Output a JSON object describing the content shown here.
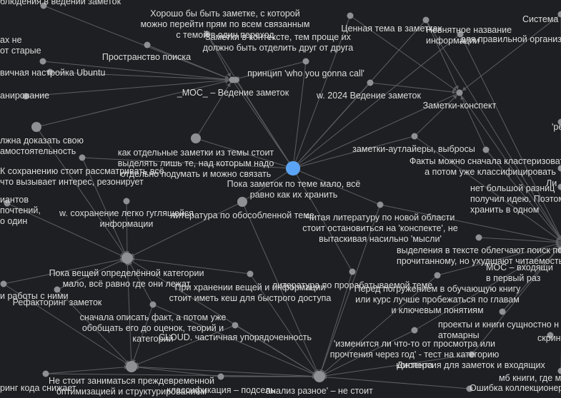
{
  "background_color": "#1e1f22",
  "edge_color": "#5d5f63",
  "node_color": "#8f9094",
  "active_node_color": "#5ba4f5",
  "label_color": "#dcdcdc",
  "nodes": [
    {
      "id": "center",
      "label": "Пока заметок по теме мало, всё\nравно как их хранить",
      "active": true
    },
    {
      "id": "n1",
      "label": "Хорошо бы быть заметке, с которой\nможно перейти прям по всем связанным\nс темой в один переход"
    },
    {
      "id": "n2",
      "label": "Заметки в контексте, тем проще их\nдолжно быть отделить друг от друга"
    },
    {
      "id": "n3",
      "label": "Ценная тема в заметках"
    },
    {
      "id": "n4",
      "label": "Пространство поиска"
    },
    {
      "id": "n5",
      "label": "принцип 'who you gonna call'"
    },
    {
      "id": "n6",
      "label": "_МОС_ – Ведение заметок"
    },
    {
      "id": "n7",
      "label": "w. 2024 Ведение заметок"
    },
    {
      "id": "n8",
      "label": "Заметки-конспект"
    },
    {
      "id": "n9",
      "label": "заметки-аутлайеры, выбросы"
    },
    {
      "id": "n10",
      "label": "Факты можно сначала кластеризовать,\nа потом уже классифицировать"
    },
    {
      "id": "n11",
      "label": "как отдельные заметки из темы стоит\nвыделять лишь те, над которым надо\nотдельно подумать и можно связать"
    },
    {
      "id": "n12",
      "label": "К сохранению стоит рассматривать всё,\nчто вызывает интерес, резонирует"
    },
    {
      "id": "n13",
      "label": "w. сохранение легко гуглящейся\nинформации"
    },
    {
      "id": "n14",
      "label": "литература по обособленной теме"
    },
    {
      "id": "n15",
      "label": "Читая литературу по новой области\nстоит остановиться на 'конспекте', не\nвытаскивая насильно 'мысли'"
    },
    {
      "id": "n16",
      "label": "выделения в тексте облегчают поиск по\nпрочитанному, но ухудшают читаемость"
    },
    {
      "id": "n17",
      "label": "МОС – входящи\nв первый раз"
    },
    {
      "id": "n18",
      "label": "Пока вещей определённой категории\nмало, всё равно где они лежат"
    },
    {
      "id": "n19",
      "label": "При хранении вещей и информации\nстоит иметь кеш для быстрого доступа"
    },
    {
      "id": "n20",
      "label": "литература по прорабатываемой теме"
    },
    {
      "id": "n21",
      "label": "Перед погружением в обучающую книгу\nили курс лучше пробежаться по главам\nи ключевым понятиям"
    },
    {
      "id": "n22",
      "label": "Рефакторинг заметок"
    },
    {
      "id": "n23",
      "label": "сначала описать факт, а потом уже\nобобщать его до оценок, теорий и\nкатегорий"
    },
    {
      "id": "n24",
      "label": "CLOUD. частичная упорядоченность"
    },
    {
      "id": "n25",
      "label": "проекты и книги сущностно н\nатомарны"
    },
    {
      "id": "n26",
      "label": "'изменится ли что-то от просмотра или\nпрочтения через год' - тест на категорию\nконтента"
    },
    {
      "id": "n27",
      "label": "Не стоит заниматься преждевременной\nоптимизацией и структурированием"
    },
    {
      "id": "n28",
      "label": "классификация – подсель"
    },
    {
      "id": "n29",
      "label": "анализ разное' – не стоит"
    },
    {
      "id": "n30",
      "label": "Дисперсия для заметок и входящих"
    },
    {
      "id": "n31",
      "label": "мб книги, где м"
    },
    {
      "id": "n32",
      "label": "Ошибка коллекционера"
    },
    {
      "id": "n33",
      "label": "нет большой разниц\nполучил идею. Поэтом\nхранить в одном"
    },
    {
      "id": "n34",
      "label": "Система"
    },
    {
      "id": "n35",
      "label": "Невнятное название\nинформации"
    },
    {
      "id": "n36",
      "label": "для правильной организац"
    },
    {
      "id": "n37",
      "label": "блюдения в ведении заметок"
    },
    {
      "id": "n38",
      "label": "ах не\nот старые"
    },
    {
      "id": "n39",
      "label": "вичная настройка Ubuntu"
    },
    {
      "id": "n40",
      "label": "анирование"
    },
    {
      "id": "n41",
      "label": "лжна доказать свою\nамостоятельность"
    },
    {
      "id": "n42",
      "label": "иантов\nпочтений,\nо один"
    },
    {
      "id": "n43",
      "label": "и работы с ними"
    },
    {
      "id": "n44",
      "label": "ринг кода снижает"
    },
    {
      "id": "n45",
      "label": "скрин"
    },
    {
      "id": "n46",
      "label": "Ли"
    },
    {
      "id": "n47",
      "label": "'ре"
    }
  ]
}
